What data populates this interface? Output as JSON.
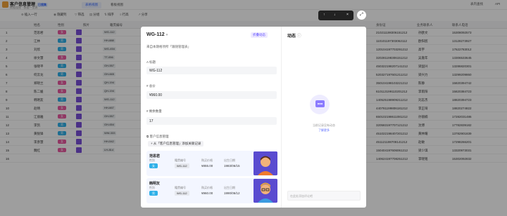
{
  "app": {
    "title": "客户信息管理",
    "badge": "已搜集",
    "subtitle": "数据连接 · 数据一览表",
    "tab1": "表格视图",
    "tab2": "看板视图",
    "search": "表内查找",
    "api": "API"
  },
  "toolbar": {
    "insert": "插入一行",
    "hide": "隐藏列",
    "filter": "筛选",
    "group": "分组",
    "sort": "排序",
    "rowheight": "行高",
    "share": "分享"
  },
  "columns": {
    "name": "姓名",
    "gender": "性别",
    "photo": "照片",
    "no": "籍贯编号",
    "id": "身份证",
    "sales": "业务联系人",
    "phone": "联系人电话"
  },
  "rows": [
    {
      "n": "1",
      "name": "范思君",
      "g": "女",
      "no": "WG-112",
      "id": "210211198306151212",
      "s": "孙欧文",
      "p": "15308092573",
      "gc": "#e85aa0"
    },
    {
      "n": "2",
      "name": "江林",
      "g": "男",
      "no": "HH-888",
      "id": "110101197303062112",
      "s": "欧阳宸",
      "p": "13128273927",
      "gc": "#2fb0e8"
    },
    {
      "n": "3",
      "name": "刘欣",
      "g": "男",
      "no": "WG-454",
      "id": "120104197703291212",
      "s": "高宇",
      "p": "17622783012",
      "gc": "#2fb0e8"
    },
    {
      "n": "4",
      "name": "徐文慧",
      "g": "女",
      "no": "TT-056",
      "id": "320281198306151212",
      "s": "吴嘉年",
      "p": "13306533645",
      "gc": "#e85aa0"
    },
    {
      "n": "5",
      "name": "张晓平",
      "g": "男",
      "no": "GH-557",
      "id": "450322198207141212",
      "s": "梁国兴",
      "p": "13286820301",
      "gc": "#2fb0e8"
    },
    {
      "n": "6",
      "name": "何云龙",
      "g": "男",
      "no": "GH-665",
      "id": "520327197601211212",
      "s": "梁兴力",
      "p": "13299209860",
      "gc": "#2fb0e8"
    },
    {
      "n": "7",
      "name": "郑晓兰",
      "g": "女",
      "no": "QH-194",
      "id": "350104198103221212",
      "s": "陈静",
      "p": "15820394742",
      "gc": "#e85aa0"
    },
    {
      "n": "8",
      "name": "陈二媛",
      "g": "女",
      "no": "QH-194",
      "id": "610113199110201212",
      "s": "李雨阳",
      "p": "15820384723",
      "gc": "#e85aa0"
    },
    {
      "n": "9",
      "name": "韩明友",
      "g": "男",
      "no": "WG-112",
      "id": "140525198909211212",
      "s": "刘志杰",
      "p": "18820394723",
      "gc": "#2fb0e8"
    },
    {
      "n": "10",
      "name": "赵晴",
      "g": "女",
      "no": "HH-667",
      "id": "440781199806181212",
      "s": "李正琦",
      "p": "18820274822",
      "gc": "#e85aa0"
    },
    {
      "n": "11",
      "name": "江丽雅",
      "g": "女",
      "no": "GH-557",
      "id": "650102198611081212",
      "s": "孙丽楠",
      "p": "17282031486",
      "gc": "#e85aa0"
    },
    {
      "n": "12",
      "name": "李凯",
      "g": "男",
      "no": "GH-654",
      "id": "320583197707121212",
      "s": "沈博",
      "p": "17782839182",
      "gc": "#2fb0e8"
    },
    {
      "n": "13",
      "name": "黄锐锋",
      "g": "男",
      "no": "WW-333",
      "id": "451022198407201212",
      "s": "黄林耀",
      "p": "13782901839",
      "gc": "#2fb0e8"
    },
    {
      "n": "14",
      "name": "李彦慧",
      "g": "女",
      "no": "HH-542",
      "id": "451121198708141212",
      "s": "赵敏",
      "p": "17298266201",
      "gc": "#e85aa0"
    },
    {
      "n": "15",
      "name": "魏红",
      "g": "女",
      "no": "LH-814",
      "id": "150404197606061212",
      "s": "梁少琪",
      "p": "13320973031",
      "gc": "#e85aa0"
    },
    {
      "n": "16",
      "name": "",
      "g": "",
      "no": "",
      "id": "140624197708251212",
      "s": "李晓铭",
      "p": "15302092832",
      "gc": "#ccc"
    }
  ],
  "floatbar": {
    "up": "↑",
    "down": "↓",
    "close": "×"
  },
  "modal": {
    "title": "WG-112",
    "followBtn": "折叠动态",
    "source": "来自本期格项所「跟随管理表」",
    "fTitle": "标题",
    "vTitle": "WG-112",
    "fPrice": "总价",
    "vPrice": "¥960.00",
    "fStock": "剩余数量",
    "vStock": "17",
    "fLink": "客户信息管理",
    "linkBtn": "+ 从「客户信息管理」添加关联记录",
    "c1": {
      "name": "范思君",
      "lg": "性别",
      "lno": "籍贯编号",
      "lp": "购买价格",
      "ld": "出生日期",
      "g": "女",
      "no": "WG-112",
      "p": "¥855.00",
      "d": "1983/06/15"
    },
    "c2": {
      "name": "韩明友",
      "lg": "性别",
      "lno": "籍贯编号",
      "lp": "购买价格",
      "ld": "出生日期",
      "g": "男",
      "no": "WG-112",
      "p": "¥960.00",
      "d": "1990/06/12"
    },
    "right": {
      "title": "动态",
      "empty1": "当前记录没有动态",
      "empty2": "了解更多",
      "comment": "在此处添加评论吧"
    }
  }
}
